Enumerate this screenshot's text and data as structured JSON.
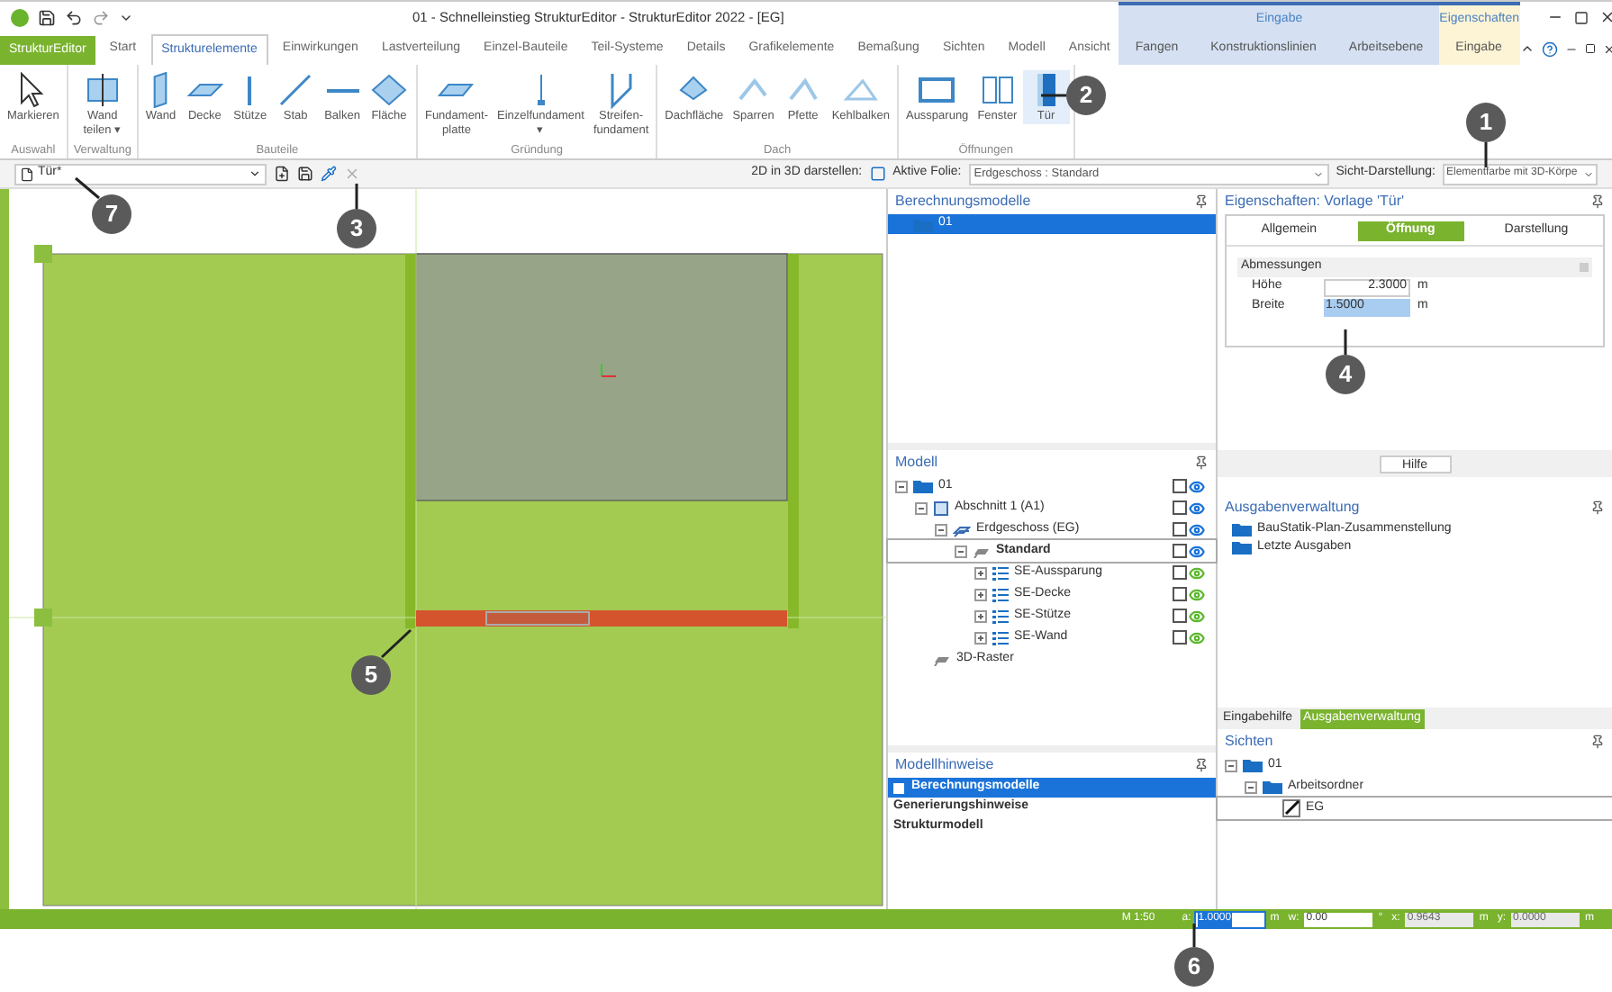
{
  "title_bar": {
    "title": "01 - Schnelleinstieg StrukturEditor - StrukturEditor 2022 - [EG]"
  },
  "context_groups": [
    {
      "label": "Eingabe",
      "color": "#d5e1f2",
      "tabs": [
        "Fangen",
        "Konstruktionslinien",
        "Arbeitsebene"
      ]
    },
    {
      "label": "Eigenschaften",
      "color": "#fdf4d6",
      "tabs": [
        "Eingabe"
      ]
    }
  ],
  "app_tab": "StrukturEditor",
  "ribbon_tabs": [
    {
      "label": "Start",
      "selected": false
    },
    {
      "label": "Strukturelemente",
      "selected": true
    },
    {
      "label": "Einwirkungen",
      "selected": false
    },
    {
      "label": "Lastverteilung",
      "selected": false
    },
    {
      "label": "Einzel-Bauteile",
      "selected": false
    },
    {
      "label": "Teil-Systeme",
      "selected": false
    },
    {
      "label": "Details",
      "selected": false
    },
    {
      "label": "Grafikelemente",
      "selected": false
    },
    {
      "label": "Bemaßung",
      "selected": false
    },
    {
      "label": "Sichten",
      "selected": false
    },
    {
      "label": "Modell",
      "selected": false
    },
    {
      "label": "Ansicht",
      "selected": false
    }
  ],
  "ribbon_groups": [
    {
      "label": "Auswahl",
      "tools": [
        {
          "label": "Markieren",
          "selected": false
        }
      ]
    },
    {
      "label": "Verwaltung",
      "tools": [
        {
          "label": "Wand teilen ▾",
          "selected": false
        }
      ]
    },
    {
      "label": "Bauteile",
      "tools": [
        {
          "label": "Wand",
          "selected": false
        },
        {
          "label": "Decke",
          "selected": false
        },
        {
          "label": "Stütze",
          "selected": false
        },
        {
          "label": "Stab",
          "selected": false
        },
        {
          "label": "Balken",
          "selected": false
        },
        {
          "label": "Fläche",
          "selected": false
        }
      ]
    },
    {
      "label": "Gründung",
      "tools": [
        {
          "label": "Fundament-platte",
          "selected": false
        },
        {
          "label": "Einzelfundament ▾",
          "selected": false
        },
        {
          "label": "Streifen-fundament",
          "selected": false
        }
      ]
    },
    {
      "label": "Dach",
      "tools": [
        {
          "label": "Dachfläche",
          "selected": false
        },
        {
          "label": "Sparren",
          "selected": false
        },
        {
          "label": "Pfette",
          "selected": false
        },
        {
          "label": "Kehlbalken",
          "selected": false
        }
      ]
    },
    {
      "label": "Öffnungen",
      "tools": [
        {
          "label": "Aussparung",
          "selected": false
        },
        {
          "label": "Fenster",
          "selected": false
        },
        {
          "label": "Tür",
          "selected": true
        }
      ]
    }
  ],
  "toolbar": {
    "template": "Tür*",
    "view_2d3d_label": "2D in 3D darstellen:",
    "layer_label": "Aktive Folie:",
    "layer_value": "Erdgeschoss : Standard",
    "display_label": "Sicht-Darstellung:",
    "display_value": "Elementfarbe mit 3D-Körpe"
  },
  "berechnungsmodelle": {
    "title": "Berechnungsmodelle",
    "items": [
      {
        "label": "01",
        "selected": true
      }
    ]
  },
  "modell": {
    "title": "Modell",
    "tree": [
      {
        "label": "01",
        "kind": "folder",
        "checked": false,
        "color": "#1a73d9",
        "selected": false,
        "children": [
          {
            "label": "Abschnitt 1 (A1)",
            "kind": "building",
            "checked": false,
            "color": "#1a73d9",
            "selected": false,
            "children": [
              {
                "label": "Erdgeschoss (EG)",
                "kind": "floor",
                "checked": false,
                "color": "#1a73d9",
                "selected": false,
                "children": [
                  {
                    "label": "Standard",
                    "kind": "layer",
                    "checked": false,
                    "color": "#1a73d9",
                    "selected": true,
                    "children": [
                      {
                        "label": "SE-Aussparung",
                        "kind": "group",
                        "checked": false,
                        "color": "#5cb82e",
                        "selected": false,
                        "collapsed": true
                      },
                      {
                        "label": "SE-Decke",
                        "kind": "group",
                        "checked": false,
                        "color": "#5cb82e",
                        "selected": false,
                        "collapsed": true
                      },
                      {
                        "label": "SE-Stütze",
                        "kind": "group",
                        "checked": false,
                        "color": "#5cb82e",
                        "selected": false,
                        "collapsed": true
                      },
                      {
                        "label": "SE-Wand",
                        "kind": "group",
                        "checked": false,
                        "color": "#5cb82e",
                        "selected": false,
                        "collapsed": true
                      }
                    ]
                  }
                ]
              }
            ]
          },
          {
            "label": "3D-Raster",
            "kind": "layer",
            "selected": false
          }
        ]
      }
    ]
  },
  "modellhinweise": {
    "title": "Modellhinweise",
    "items": [
      {
        "label": "Berechnungsmodelle",
        "selected": true,
        "expandable": true
      },
      {
        "label": "Generierungshinweise",
        "selected": false,
        "expandable": false
      },
      {
        "label": "Strukturmodell",
        "selected": false,
        "expandable": false
      }
    ]
  },
  "eigenschaften": {
    "title": "Eigenschaften: Vorlage 'Tür'",
    "tabs": [
      {
        "label": "Allgemein",
        "selected": false
      },
      {
        "label": "Öffnung",
        "selected": true
      },
      {
        "label": "Darstellung",
        "selected": false
      }
    ],
    "section": "Abmessungen",
    "fields": [
      {
        "label": "Höhe",
        "value": "2.3000",
        "unit": "m",
        "selected": false
      },
      {
        "label": "Breite",
        "value": "1.5000",
        "unit": "m",
        "selected": true
      }
    ],
    "help_button": "Hilfe"
  },
  "ausgabenverwaltung": {
    "title": "Ausgabenverwaltung",
    "items": [
      "BauStatik-Plan-Zusammenstellung",
      "Letzte Ausgaben"
    ]
  },
  "bottom_tabs": [
    {
      "label": "Eingabehilfe",
      "selected": false
    },
    {
      "label": "Ausgabenverwaltung",
      "selected": true
    }
  ],
  "sichten": {
    "title": "Sichten",
    "tree": [
      {
        "label": "01",
        "kind": "folder",
        "selected": false,
        "children": [
          {
            "label": "Arbeitsordner",
            "kind": "folder",
            "selected": false,
            "children": [
              {
                "label": "EG",
                "kind": "view",
                "selected": true
              }
            ]
          }
        ]
      }
    ]
  },
  "status_bar": {
    "scale": "M 1:50",
    "fields": [
      {
        "label": "a:",
        "value": "1.0000",
        "unit": "m",
        "selected": true,
        "disabled": false
      },
      {
        "label": "w:",
        "value": "0.00",
        "unit": "°",
        "selected": false,
        "disabled": false
      },
      {
        "label": "x:",
        "value": "0.9643",
        "unit": "m",
        "selected": false,
        "disabled": true
      },
      {
        "label": "y:",
        "value": "0.0000",
        "unit": "m",
        "selected": false,
        "disabled": true
      }
    ]
  },
  "callouts": [
    {
      "label": "1"
    },
    {
      "label": "2"
    },
    {
      "label": "3"
    },
    {
      "label": "4"
    },
    {
      "label": "5"
    },
    {
      "label": "6"
    },
    {
      "label": "7"
    }
  ]
}
